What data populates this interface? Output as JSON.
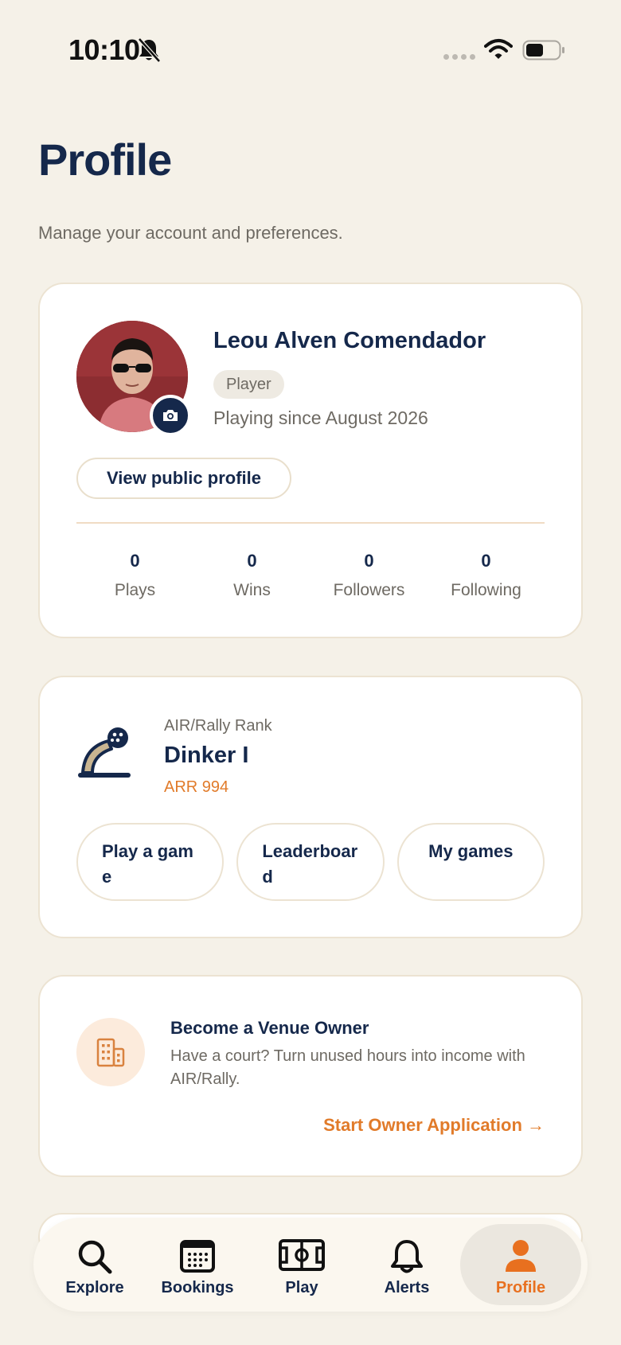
{
  "status_bar": {
    "time": "10:10"
  },
  "header": {
    "title": "Profile",
    "subtitle": "Manage your account and preferences."
  },
  "profile": {
    "name": "Leou Alven Comendador",
    "role": "Player",
    "since": "Playing since August 2026",
    "public_button": "View public profile",
    "stats": [
      {
        "value": "0",
        "label": "Plays"
      },
      {
        "value": "0",
        "label": "Wins"
      },
      {
        "value": "0",
        "label": "Followers"
      },
      {
        "value": "0",
        "label": "Following"
      }
    ]
  },
  "rank": {
    "caption": "AIR/Rally Rank",
    "name": "Dinker I",
    "score": "ARR 994",
    "buttons": [
      "Play a game",
      "Leaderboard",
      "My games"
    ]
  },
  "venue": {
    "title": "Become a Venue Owner",
    "description": "Have a court? Turn unused hours into income with AIR/Rally.",
    "link": "Start Owner Application →"
  },
  "tabs": [
    {
      "label": "Explore",
      "icon": "search-icon"
    },
    {
      "label": "Bookings",
      "icon": "calendar-icon"
    },
    {
      "label": "Play",
      "icon": "court-icon"
    },
    {
      "label": "Alerts",
      "icon": "bell-icon"
    },
    {
      "label": "Profile",
      "icon": "person-icon"
    }
  ],
  "colors": {
    "background": "#f5f1e8",
    "navy": "#15284b",
    "accent_orange": "#e8701f",
    "muted_text": "#6e6a63"
  }
}
